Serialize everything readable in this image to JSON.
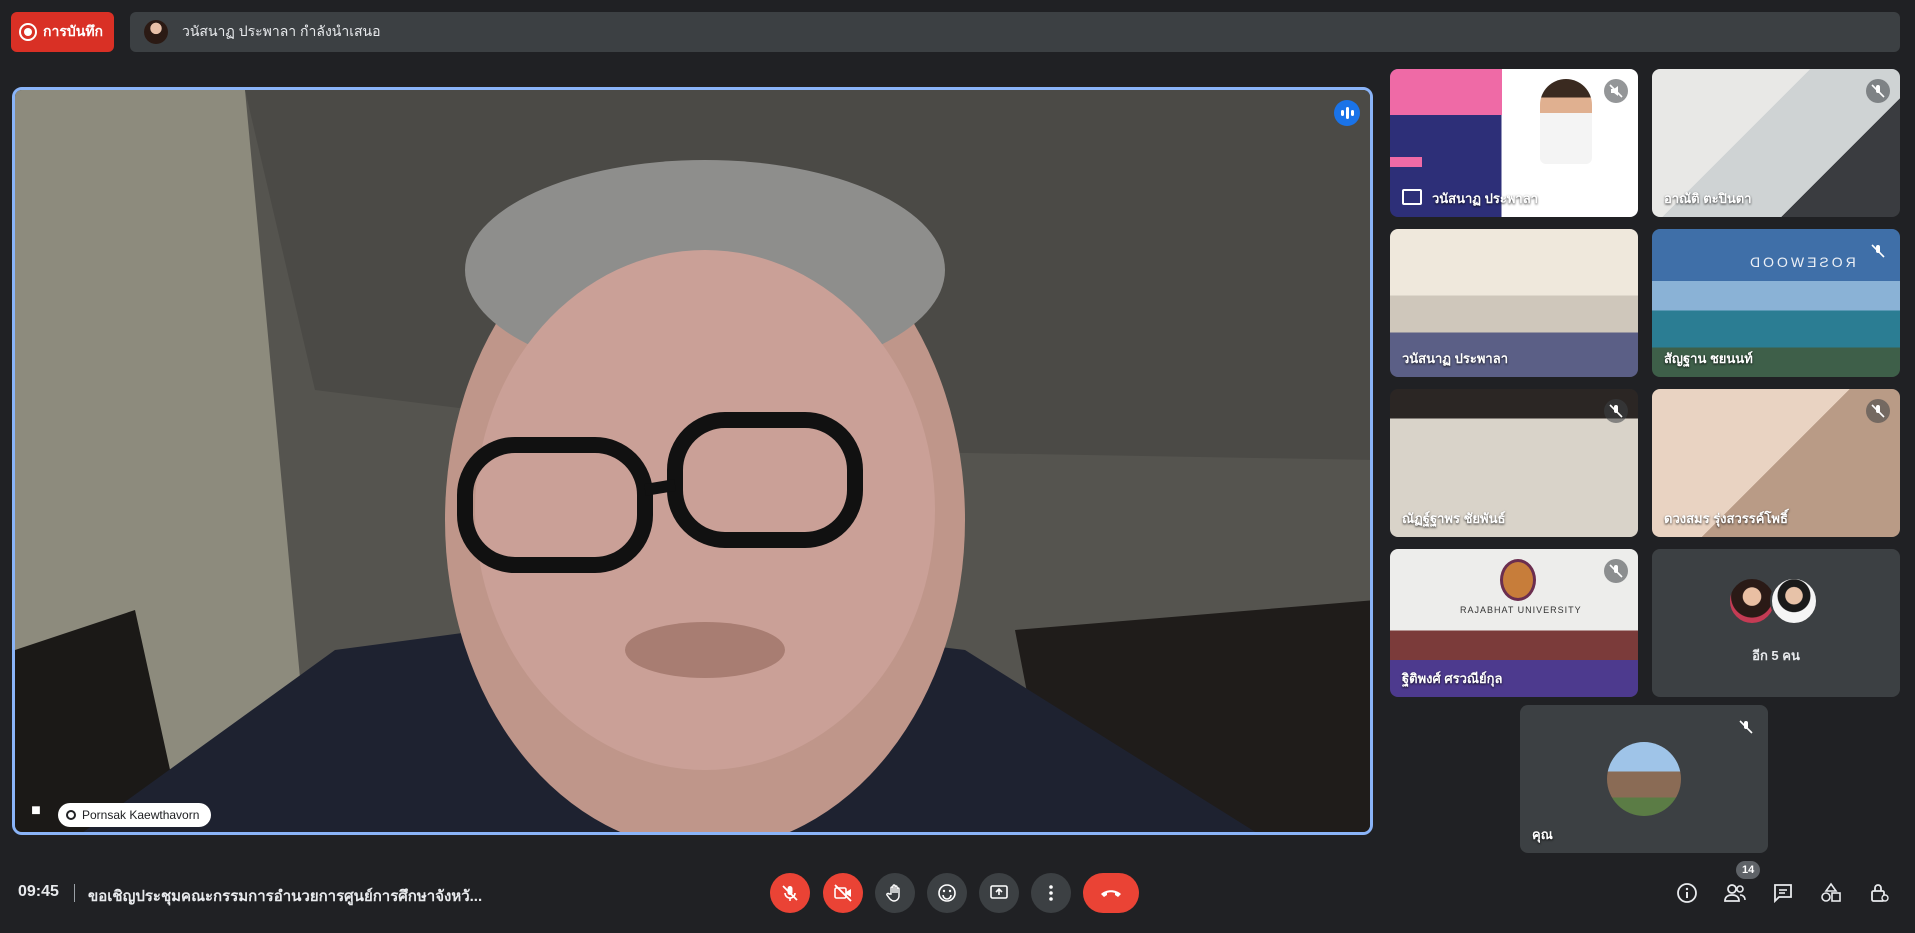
{
  "recording": {
    "label": "การบันทึก"
  },
  "presentation": {
    "text": "วนัสนาฏ ประพาลา กำลังนำเสนอ"
  },
  "main_speaker": {
    "name": "Pornsak Kaewthavorn",
    "speaking": true,
    "pinned": true
  },
  "tiles": [
    {
      "name": "วนัสนาฏ ประพาลา",
      "muted": true,
      "presenting": true
    },
    {
      "name": "อาณัติ ตะปินตา",
      "muted": true
    },
    {
      "name": "วนัสนาฏ ประพาลา",
      "muted": false
    },
    {
      "name": "สัญฐาน ชยนนท์",
      "muted": true
    },
    {
      "name": "ณัฏฐ์ฐาพร ชัยพันธ์",
      "muted": true
    },
    {
      "name": "ดวงสมร รุ่งสวรรค์โพธิ์",
      "muted": true
    },
    {
      "name": "ฐิติพงศ์ ศรวณีย์กุล",
      "muted": true
    }
  ],
  "overflow_tile": {
    "label": "อีก 5 คน"
  },
  "self_tile": {
    "name": "คุณ",
    "muted": true
  },
  "tile_texts": {
    "brand": "ROSEWOOD",
    "university": "RAJABHAT UNIVERSITY"
  },
  "bottom": {
    "time": "09:45",
    "meeting_title": "ขอเชิญประชุมคณะกรรมการอำนวยการศูนย์การศึกษาจังหวั...",
    "participant_count": "14"
  },
  "icons": [
    "record-icon",
    "mic-off-icon",
    "camera-off-icon",
    "raise-hand-icon",
    "emoji-icon",
    "present-icon",
    "more-icon",
    "end-call-icon",
    "info-icon",
    "people-icon",
    "chat-icon",
    "activities-icon",
    "host-controls-icon"
  ],
  "colors": {
    "accent": "#8ab4f8",
    "danger": "#ea4335",
    "background": "#202124",
    "surface": "#3c4043"
  }
}
